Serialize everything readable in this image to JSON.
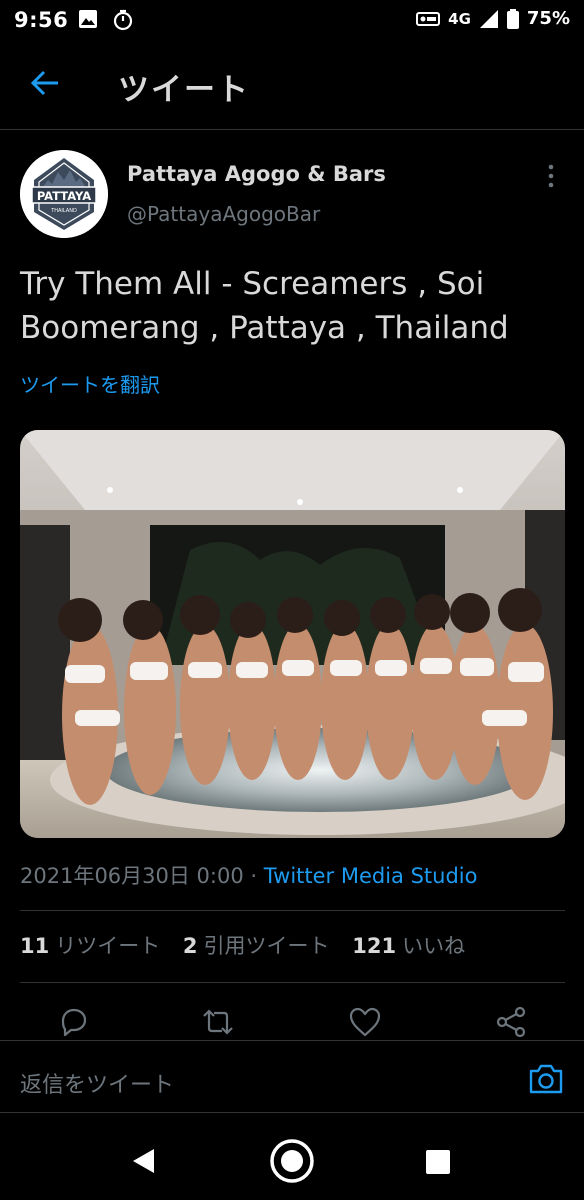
{
  "status_bar": {
    "time": "9:56",
    "network": "4G",
    "battery": "75%",
    "icons": [
      "image-icon",
      "timer-icon",
      "vpn-icon",
      "signal-icon",
      "battery-icon"
    ]
  },
  "header": {
    "title": "ツイート",
    "back_icon": "arrow-left-icon"
  },
  "tweet": {
    "author_name": "Pattaya Agogo & Bars",
    "author_handle": "@PattayaAgogoBar",
    "avatar_text": "PATTAYA",
    "avatar_subtext": "THAILAND",
    "text": "Try Them All - Screamers , Soi Boomerang , Pattaya , Thailand",
    "translate_label": "ツイートを翻訳",
    "date": "2021年06月30日 0:00",
    "separator": "·",
    "source": "Twitter Media Studio"
  },
  "stats": {
    "retweets_count": "11",
    "retweets_label": "リツイート",
    "quotes_count": "2",
    "quotes_label": "引用ツイート",
    "likes_count": "121",
    "likes_label": "いいね"
  },
  "actions": [
    "reply-icon",
    "retweet-icon",
    "like-icon",
    "share-icon"
  ],
  "reply": {
    "placeholder": "返信をツイート"
  },
  "colors": {
    "background": "#000000",
    "accent": "#1d9bf0",
    "text": "#d9d9d9",
    "secondary": "#6e767d",
    "divider": "#2f3336"
  }
}
